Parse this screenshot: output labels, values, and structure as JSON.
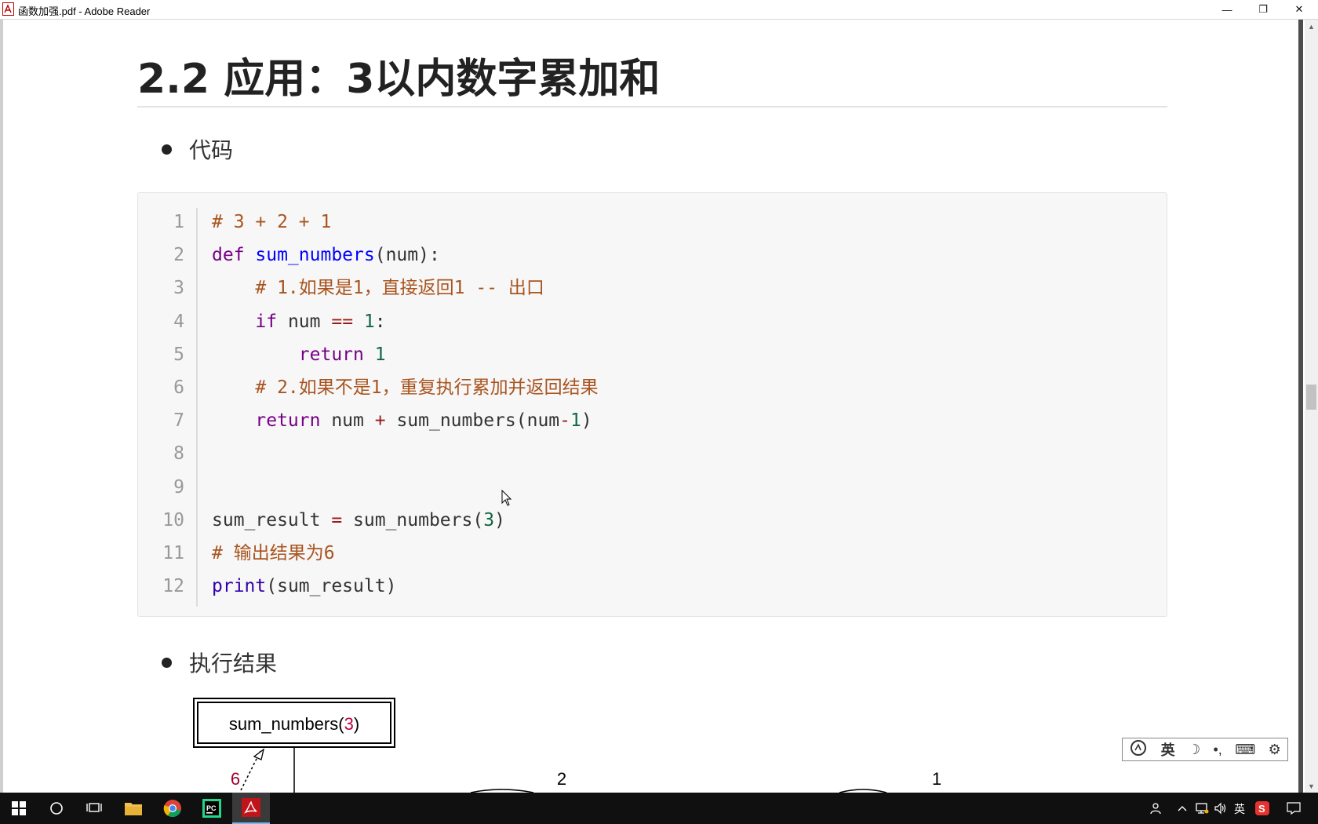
{
  "window": {
    "title": "函数加强.pdf - Adobe Reader",
    "minimize": "—",
    "restore": "❐",
    "close": "✕"
  },
  "document": {
    "heading": "2.2 应用：3以内数字累加和",
    "bullet1": "代码",
    "bullet2": "执行结果",
    "code_lines": [
      {
        "n": "1",
        "tokens": [
          {
            "t": "# 3 + 2 + 1",
            "c": "comment"
          }
        ]
      },
      {
        "n": "2",
        "tokens": [
          {
            "t": "def ",
            "c": "kw"
          },
          {
            "t": "sum_numbers",
            "c": "def"
          },
          {
            "t": "(num):",
            "c": ""
          }
        ]
      },
      {
        "n": "3",
        "tokens": [
          {
            "t": "    ",
            "c": ""
          },
          {
            "t": "# 1.如果是1，直接返回1 -- 出口",
            "c": "comment"
          }
        ]
      },
      {
        "n": "4",
        "tokens": [
          {
            "t": "    ",
            "c": ""
          },
          {
            "t": "if",
            "c": "kw"
          },
          {
            "t": " num ",
            "c": ""
          },
          {
            "t": "==",
            "c": "op"
          },
          {
            "t": " ",
            "c": ""
          },
          {
            "t": "1",
            "c": "num"
          },
          {
            "t": ":",
            "c": ""
          }
        ]
      },
      {
        "n": "5",
        "tokens": [
          {
            "t": "        ",
            "c": ""
          },
          {
            "t": "return",
            "c": "kw"
          },
          {
            "t": " ",
            "c": ""
          },
          {
            "t": "1",
            "c": "num"
          }
        ]
      },
      {
        "n": "6",
        "tokens": [
          {
            "t": "    ",
            "c": ""
          },
          {
            "t": "# 2.如果不是1，重复执行累加并返回结果",
            "c": "comment"
          }
        ]
      },
      {
        "n": "7",
        "tokens": [
          {
            "t": "    ",
            "c": ""
          },
          {
            "t": "return",
            "c": "kw"
          },
          {
            "t": " num ",
            "c": ""
          },
          {
            "t": "+",
            "c": "op"
          },
          {
            "t": " sum_numbers(num",
            "c": ""
          },
          {
            "t": "-",
            "c": "op"
          },
          {
            "t": "1",
            "c": "num"
          },
          {
            "t": ")",
            "c": ""
          }
        ]
      },
      {
        "n": "8",
        "tokens": []
      },
      {
        "n": "9",
        "tokens": []
      },
      {
        "n": "10",
        "tokens": [
          {
            "t": "sum_result ",
            "c": ""
          },
          {
            "t": "=",
            "c": "op"
          },
          {
            "t": " sum_numbers(",
            "c": ""
          },
          {
            "t": "3",
            "c": "num"
          },
          {
            "t": ")",
            "c": ""
          }
        ]
      },
      {
        "n": "11",
        "tokens": [
          {
            "t": "# 输出结果为6",
            "c": "comment"
          }
        ]
      },
      {
        "n": "12",
        "tokens": [
          {
            "t": "print",
            "c": "builtin"
          },
          {
            "t": "(sum_result)",
            "c": ""
          }
        ]
      }
    ],
    "diagram": {
      "box_prefix": "sum_numbers(",
      "box_arg": "3",
      "box_suffix": ")",
      "return_value": "6",
      "label_2": "2",
      "label_1": "1"
    }
  },
  "ime": {
    "lang": "英",
    "moon": "☽",
    "punct": "•,",
    "keyboard": "⌨",
    "settings": "⚙"
  },
  "tray": {
    "lang": "英"
  }
}
